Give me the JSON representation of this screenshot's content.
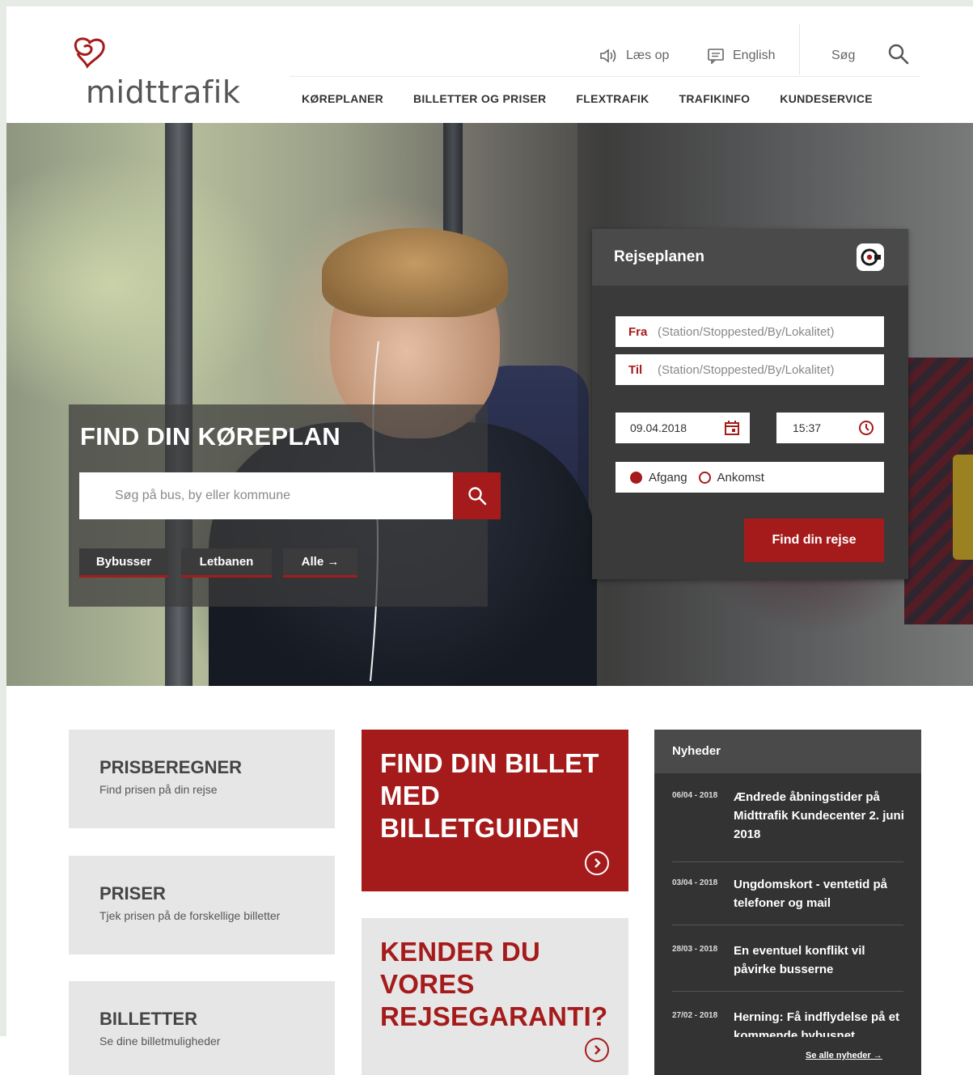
{
  "header": {
    "logo_text": "midttrafik",
    "read_aloud": "Læs op",
    "language": "English",
    "search_label": "Søg"
  },
  "nav": {
    "items": [
      "KØREPLANER",
      "BILLETTER OG PRISER",
      "FLEXTRAFIK",
      "TRAFIKINFO",
      "KUNDESERVICE"
    ]
  },
  "find_koreplan": {
    "title": "FIND DIN KØREPLAN",
    "placeholder": "Søg på bus, by eller kommune",
    "tags": [
      "Bybusser",
      "Letbanen",
      "Alle →"
    ]
  },
  "rejseplanen": {
    "title": "Rejseplanen",
    "from_label": "Fra",
    "from_placeholder": "(Station/Stoppested/By/Lokalitet)",
    "to_label": "Til",
    "to_placeholder": "(Station/Stoppested/By/Lokalitet)",
    "date": "09.04.2018",
    "time": "15:37",
    "radio_departure": "Afgang",
    "radio_arrival": "Ankomst",
    "submit": "Find din rejse"
  },
  "cards": [
    {
      "title": "PRISBEREGNER",
      "subtitle": "Find prisen på din rejse"
    },
    {
      "title": "PRISER",
      "subtitle": "Tjek prisen på de forskellige billetter"
    },
    {
      "title": "BILLETTER",
      "subtitle": "Se dine billetmuligheder"
    }
  ],
  "promos": [
    {
      "line1": "FIND DIN BILLET",
      "line2": "MED",
      "line3": "BILLETGUIDEN"
    },
    {
      "line1": "KENDER DU",
      "line2": "VORES",
      "line3": "REJSEGARANTI?"
    }
  ],
  "news": {
    "title": "Nyheder",
    "items": [
      {
        "date": "06/04 - 2018",
        "text": "Ændrede åbningstider på Midttrafik Kundecenter 2. juni 2018"
      },
      {
        "date": "03/04 - 2018",
        "text": "Ungdomskort - ventetid på telefoner og mail"
      },
      {
        "date": "28/03 - 2018",
        "text": "En eventuel konflikt vil påvirke busserne"
      },
      {
        "date": "27/02 - 2018",
        "text": "Herning: Få indflydelse på et kommende bybusnet"
      }
    ],
    "see_all": "Se alle nyheder →"
  },
  "colors": {
    "brand_red": "#a51b1b",
    "dark_panel": "#333333",
    "card_gray": "#e6e6e6"
  }
}
